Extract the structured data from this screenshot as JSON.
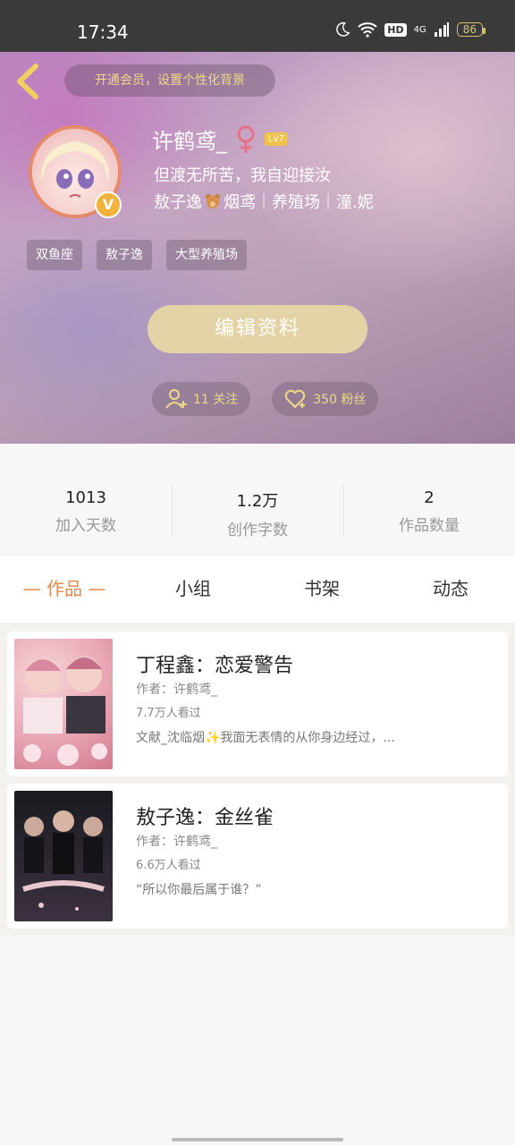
{
  "status_bar": {
    "time": "17:34",
    "hd": "HD",
    "network": "4G",
    "battery": "86"
  },
  "header": {
    "vip_prompt": "开通会员，设置个性化背景",
    "username": "许鹤鸢_",
    "level": "Lv7",
    "bio_line1": "但渡无所苦，我自迎接汝",
    "bio_line2_a": "敖子逸",
    "bio_line2_b": "烟鸢｜养殖场｜潼.妮",
    "tags": [
      "双鱼座",
      "敖子逸",
      "大型养殖场"
    ],
    "edit_profile": "编辑资料",
    "following": "11 关注",
    "followers": "350 粉丝"
  },
  "stats": [
    {
      "value": "1013",
      "label": "加入天数"
    },
    {
      "value": "1.2万",
      "label": "创作字数"
    },
    {
      "value": "2",
      "label": "作品数量"
    }
  ],
  "tabs": [
    "— 作品 —",
    "小组",
    "书架",
    "动态"
  ],
  "works": [
    {
      "title": "丁程鑫：恋爱警告",
      "author": "作者：许鹤鸢_",
      "views": "7.7万人看过",
      "desc": "文献_沈临烟✨我面无表情的从你身边经过，..."
    },
    {
      "title": "敖子逸：金丝雀",
      "author": "作者：许鹤鸢_",
      "views": "6.6万人看过",
      "desc": "“所以你最后属于谁？”"
    }
  ],
  "colors": {
    "accent": "#e58a4e",
    "gold": "#f0d88a",
    "edit_button": "#e3d3a6"
  }
}
